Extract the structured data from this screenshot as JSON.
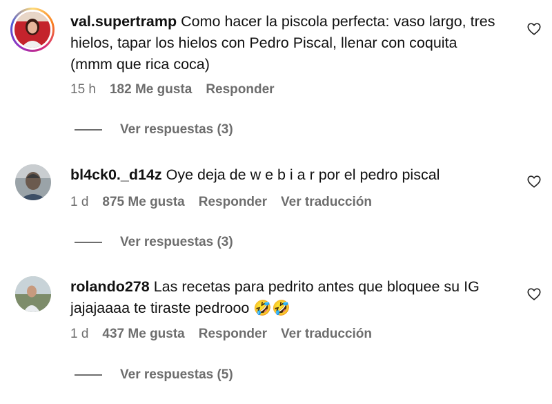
{
  "comments": [
    {
      "username": "val.supertramp",
      "text": "Como hacer la piscola perfecta: vaso largo, tres hielos, tapar los hielos con Pedro Piscal, llenar con coquita (mmm que rica coca)",
      "time": "15 h",
      "likes": "182 Me gusta",
      "reply": "Responder",
      "translate": "",
      "view_replies": "Ver respuestas (3)"
    },
    {
      "username": "bl4ck0._d14z",
      "text": "Oye deja de w e b i a r por el pedro piscal",
      "time": "1 d",
      "likes": "875 Me gusta",
      "reply": "Responder",
      "translate": "Ver traducción",
      "view_replies": "Ver respuestas (3)"
    },
    {
      "username": "rolando278",
      "text": "Las recetas para pedrito antes que bloquee su IG jajajaaaa te tiraste pedrooo 🤣🤣",
      "time": "1 d",
      "likes": "437 Me gusta",
      "reply": "Responder",
      "translate": "Ver traducción",
      "view_replies": "Ver respuestas (5)"
    }
  ],
  "icons": {
    "like": "heart-outline-icon"
  },
  "colors": {
    "text": "#111111",
    "secondary": "#6d6d6d",
    "background": "#ffffff"
  }
}
